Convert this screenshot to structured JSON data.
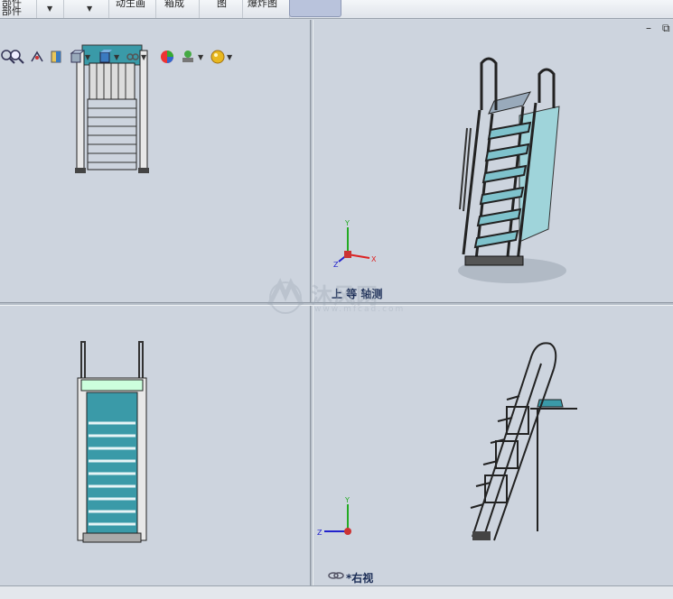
{
  "ribbon": {
    "group1_line1": "部件",
    "group1_line2": "部件",
    "group3_label": "动生画",
    "group4_label": "箱成",
    "group5_label": "图",
    "group6_label": "爆炸图"
  },
  "tab_marker": "图",
  "viewports": {
    "top_left": {
      "label": ""
    },
    "top_right": {
      "label": "*上下二等角轴测",
      "label_visible": "上  等  轴测"
    },
    "bottom_left": {
      "label": ""
    },
    "bottom_right": {
      "label": "*右视"
    }
  },
  "triad": {
    "x": "X",
    "y": "Y",
    "z": "Z"
  },
  "watermark": {
    "name": "沐风网",
    "url": "www.mfcad.com"
  },
  "window_controls": {
    "minimize": "–",
    "restore": "⧉"
  },
  "hud_icons": [
    "zoom-to-fit-icon",
    "zoom-area-icon",
    "previous-view-icon",
    "section-view-icon",
    "view-orientation-icon",
    "display-style-icon",
    "hide-show-icon",
    "edit-appearance-icon",
    "apply-scene-icon",
    "view-settings-icon"
  ],
  "colors": {
    "viewport_bg": "#cdd4de",
    "accent_teal": "#3a9aa8",
    "x_axis": "#d22",
    "y_axis": "#2a2",
    "z_axis": "#22c"
  }
}
